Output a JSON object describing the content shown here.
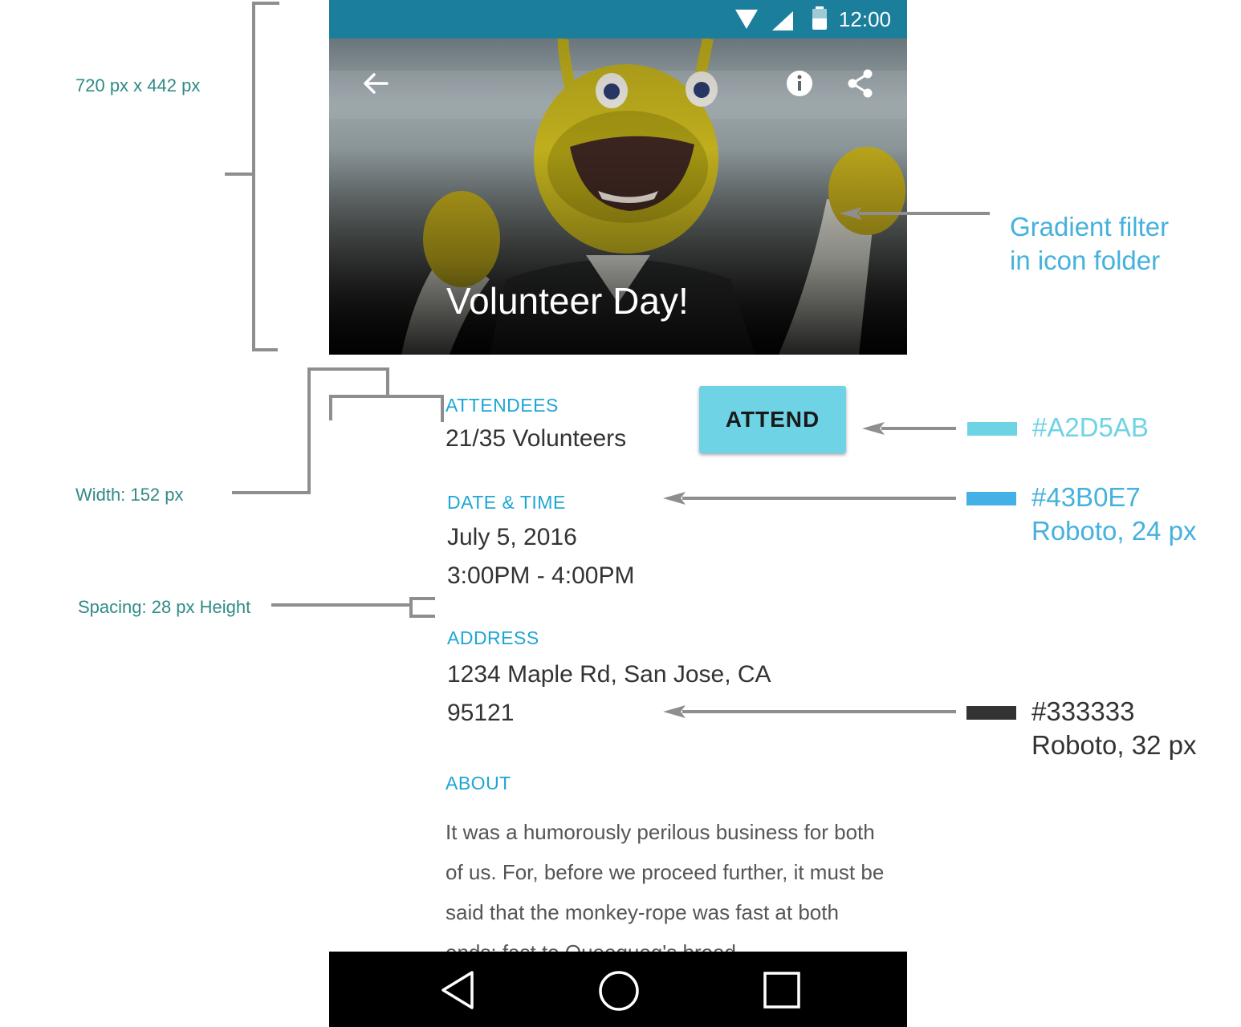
{
  "status_bar": {
    "time": "12:00"
  },
  "hero": {
    "title": "Volunteer Day!"
  },
  "attendees": {
    "label": "ATTENDEES",
    "value": "21/35 Volunteers"
  },
  "attend_button": {
    "label": "ATTEND"
  },
  "date_time": {
    "label": "DATE & TIME",
    "date": "July 5, 2016",
    "time": "3:00PM - 4:00PM"
  },
  "address": {
    "label": "ADDRESS",
    "line1": "1234 Maple Rd, San Jose, CA",
    "line2": "95121"
  },
  "about": {
    "label": "ABOUT",
    "text": "It was a humorously perilous business for both of us. For, before we proceed further, it must be said that the monkey-rope was fast at both ends: fast to Queequeg's broad"
  },
  "annotations": {
    "size": "720 px x 442 px",
    "width": "Width: 152 px",
    "spacing": "Spacing: 28 px Height",
    "gradient_line1": "Gradient filter",
    "gradient_line2": "in icon folder",
    "button_color": "#A2D5AB",
    "label_color": "#43B0E7",
    "label_font": "Roboto, 24 px",
    "text_color": "#333333",
    "text_font": "Roboto, 32 px"
  },
  "colors": {
    "status_bar": "#1b7f9c",
    "accent_label": "#1ea6d6",
    "button_fill": "#6fd3e6",
    "body_text": "#333333",
    "swatch_button": "#6fd3e6",
    "swatch_label": "#43b0e7",
    "swatch_text": "#333333"
  },
  "icons": [
    "wifi-icon",
    "signal-icon",
    "battery-icon",
    "back-arrow-icon",
    "info-icon",
    "share-icon",
    "nav-back-icon",
    "nav-home-icon",
    "nav-recents-icon"
  ]
}
